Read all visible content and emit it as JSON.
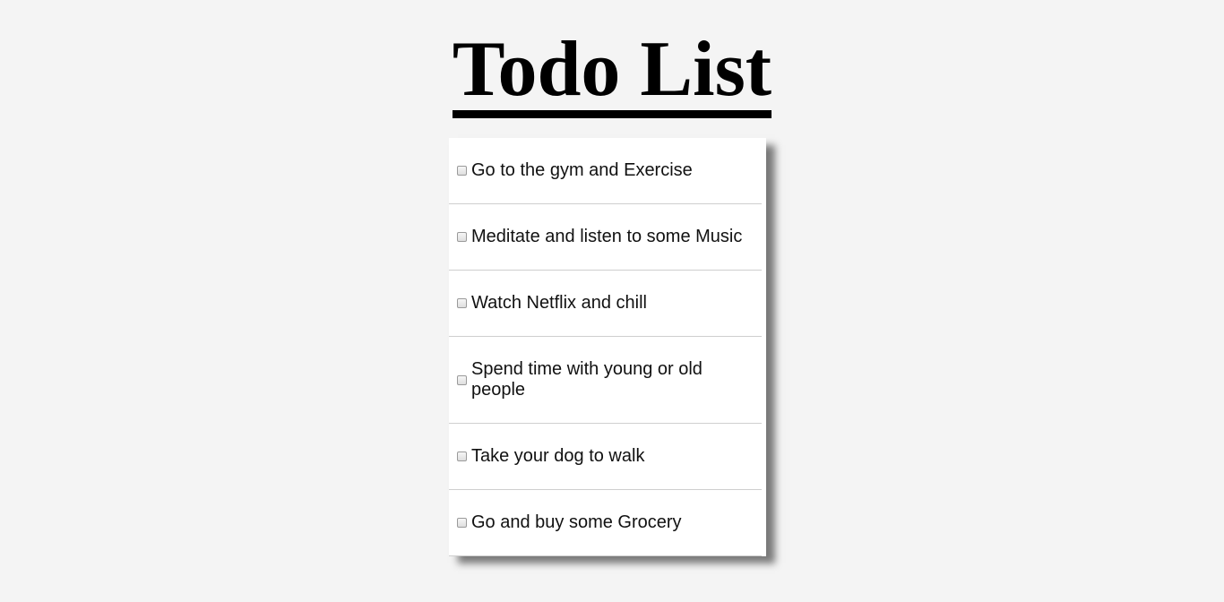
{
  "header": {
    "title": "Todo List"
  },
  "todos": [
    {
      "label": "Go to the gym and Exercise",
      "checked": false
    },
    {
      "label": "Meditate and listen to some Music",
      "checked": false
    },
    {
      "label": "Watch Netflix and chill",
      "checked": false
    },
    {
      "label": "Spend time with young or old people",
      "checked": false
    },
    {
      "label": "Take your dog to walk",
      "checked": false
    },
    {
      "label": "Go and buy some Grocery",
      "checked": false
    }
  ],
  "colors": {
    "background": "#f4f4f4",
    "card": "#ffffff",
    "divider": "#cfcfcf",
    "text": "#111111"
  }
}
